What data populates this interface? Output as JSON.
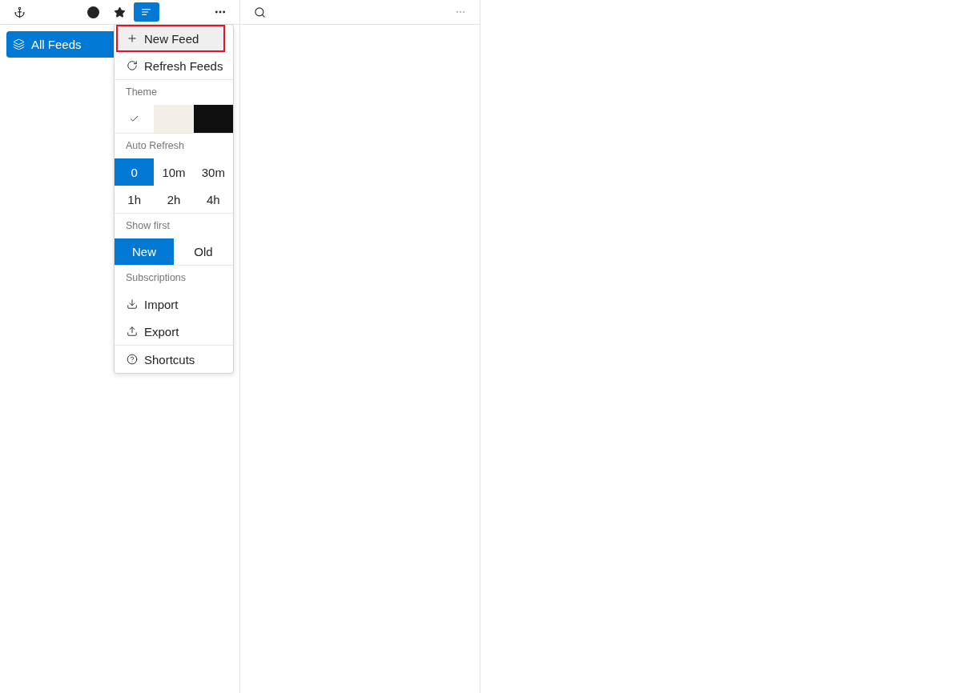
{
  "sidebar": {
    "toolbar": {
      "filters": [
        {
          "kind": "circle",
          "selected": false
        },
        {
          "kind": "star",
          "selected": false
        },
        {
          "kind": "lines",
          "selected": true
        }
      ],
      "more": {
        "disabled": false
      }
    },
    "feeds": [
      {
        "label": "All Feeds",
        "selected": true
      }
    ]
  },
  "menu": {
    "actions": [
      {
        "kind": "add",
        "label": "New Feed",
        "focused": true
      },
      {
        "kind": "refresh",
        "label": "Refresh Feeds",
        "focused": false
      }
    ],
    "theme": {
      "label": "Theme",
      "options": [
        {
          "color": "#ffffff",
          "selected": true
        },
        {
          "color": "#f3efe6",
          "selected": false
        },
        {
          "color": "#0f0f0f",
          "selected": false
        }
      ]
    },
    "auto_refresh": {
      "label": "Auto Refresh",
      "options": [
        {
          "label": "0",
          "selected": true
        },
        {
          "label": "10m",
          "selected": false
        },
        {
          "label": "30m",
          "selected": false
        },
        {
          "label": "1h",
          "selected": false
        },
        {
          "label": "2h",
          "selected": false
        },
        {
          "label": "4h",
          "selected": false
        }
      ]
    },
    "show_first": {
      "label": "Show first",
      "options": [
        {
          "label": "New",
          "selected": true
        },
        {
          "label": "Old",
          "selected": false
        }
      ]
    },
    "subscriptions": {
      "label": "Subscriptions",
      "items": [
        {
          "kind": "import",
          "label": "Import",
          "focused": false
        },
        {
          "kind": "export",
          "label": "Export",
          "focused": false
        }
      ]
    },
    "help": [
      {
        "kind": "help",
        "label": "Shortcuts",
        "focused": false
      }
    ]
  },
  "list_panel": {
    "toolbar": {
      "more": {
        "disabled": true
      }
    }
  }
}
